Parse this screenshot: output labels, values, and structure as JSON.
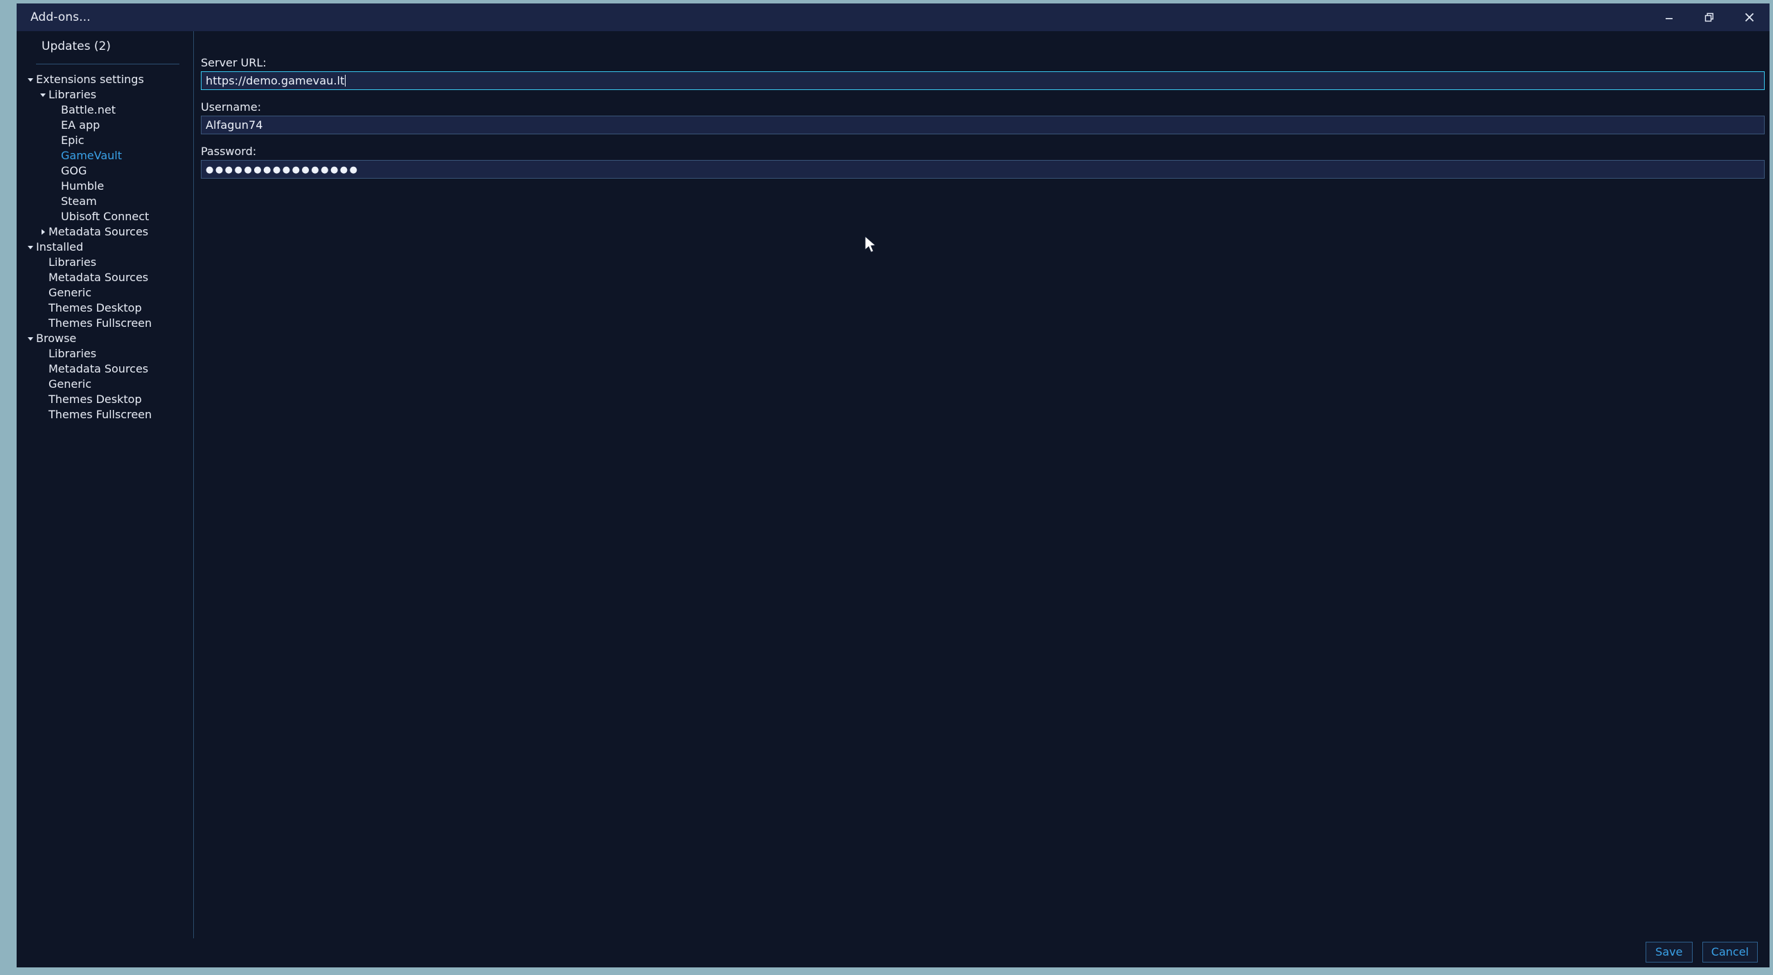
{
  "window": {
    "title": "Add-ons...",
    "controls": [
      {
        "name": "minimize",
        "label": "Minimize"
      },
      {
        "name": "restore",
        "label": "Restore"
      },
      {
        "name": "close",
        "label": "Close"
      }
    ],
    "frame_color": "#8fb3bf",
    "background_color": "#0e1526",
    "titlebar_color": "#1b2545"
  },
  "sidebar": {
    "updates_label": "Updates (2)",
    "accent_color": "#3aa2e8",
    "tree": [
      {
        "label": "Extensions settings",
        "level": 0,
        "arrow": "down",
        "selected": false
      },
      {
        "label": "Libraries",
        "level": 1,
        "arrow": "down",
        "selected": false
      },
      {
        "label": "Battle.net",
        "level": 2,
        "arrow": "none",
        "selected": false
      },
      {
        "label": "EA app",
        "level": 2,
        "arrow": "none",
        "selected": false
      },
      {
        "label": "Epic",
        "level": 2,
        "arrow": "none",
        "selected": false
      },
      {
        "label": "GameVault",
        "level": 2,
        "arrow": "none",
        "selected": true
      },
      {
        "label": "GOG",
        "level": 2,
        "arrow": "none",
        "selected": false
      },
      {
        "label": "Humble",
        "level": 2,
        "arrow": "none",
        "selected": false
      },
      {
        "label": "Steam",
        "level": 2,
        "arrow": "none",
        "selected": false
      },
      {
        "label": "Ubisoft Connect",
        "level": 2,
        "arrow": "none",
        "selected": false
      },
      {
        "label": "Metadata Sources",
        "level": 1,
        "arrow": "right",
        "selected": false
      },
      {
        "label": "Installed",
        "level": 0,
        "arrow": "down",
        "selected": false
      },
      {
        "label": "Libraries",
        "level": 1,
        "arrow": "none",
        "selected": false
      },
      {
        "label": "Metadata Sources",
        "level": 1,
        "arrow": "none",
        "selected": false
      },
      {
        "label": "Generic",
        "level": 1,
        "arrow": "none",
        "selected": false
      },
      {
        "label": "Themes Desktop",
        "level": 1,
        "arrow": "none",
        "selected": false
      },
      {
        "label": "Themes Fullscreen",
        "level": 1,
        "arrow": "none",
        "selected": false
      },
      {
        "label": "Browse",
        "level": 0,
        "arrow": "down",
        "selected": false
      },
      {
        "label": "Libraries",
        "level": 1,
        "arrow": "none",
        "selected": false
      },
      {
        "label": "Metadata Sources",
        "level": 1,
        "arrow": "none",
        "selected": false
      },
      {
        "label": "Generic",
        "level": 1,
        "arrow": "none",
        "selected": false
      },
      {
        "label": "Themes Desktop",
        "level": 1,
        "arrow": "none",
        "selected": false
      },
      {
        "label": "Themes Fullscreen",
        "level": 1,
        "arrow": "none",
        "selected": false
      }
    ]
  },
  "form": {
    "server_url": {
      "label": "Server URL:",
      "value": "https://demo.gamevau.lt",
      "focused": true,
      "focus_border_color": "#39c8f0"
    },
    "username": {
      "label": "Username:",
      "value": "Alfagun74",
      "focused": false
    },
    "password": {
      "label": "Password:",
      "value": "●●●●●●●●●●●●●●●●",
      "focused": false,
      "masked": true
    }
  },
  "footer": {
    "save_label": "Save",
    "cancel_label": "Cancel"
  }
}
